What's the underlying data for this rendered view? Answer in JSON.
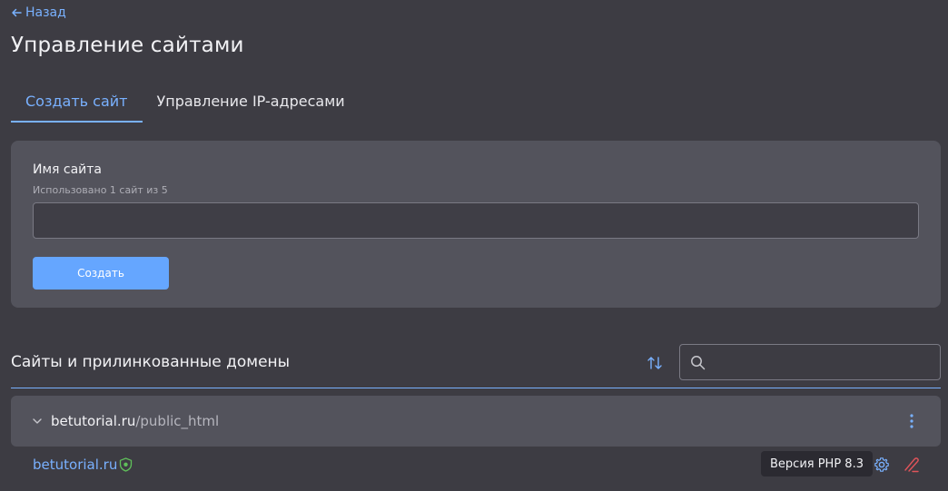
{
  "nav": {
    "back_label": "Назад"
  },
  "page": {
    "title": "Управление сайтами"
  },
  "tabs": [
    {
      "label": "Создать сайт",
      "active": true
    },
    {
      "label": "Управление IP-адресами",
      "active": false
    }
  ],
  "create_form": {
    "label": "Имя сайта",
    "hint": "Использовано 1 сайт из 5",
    "input_value": "",
    "button_label": "Создать"
  },
  "sites_section": {
    "title": "Сайты и прилинкованные домены",
    "search_value": "",
    "sites": [
      {
        "domain": "betutorial.ru",
        "path": "/public_html",
        "linked_domains": [
          {
            "domain": "betutorial.ru",
            "php_version": "Версия PHP 8.3"
          }
        ]
      }
    ]
  },
  "colors": {
    "background": "#3d3c43",
    "card": "#53535c",
    "accent": "#79b1ff",
    "primary_button": "#65a6ff",
    "ssl_shield": "#5fbf5a",
    "delete": "#e0545a"
  },
  "icons": [
    "arrow-left-icon",
    "sort-icon",
    "search-icon",
    "chevron-down-icon",
    "kebab-menu-icon",
    "ssl-shield-icon",
    "gear-icon",
    "unlink-icon"
  ]
}
